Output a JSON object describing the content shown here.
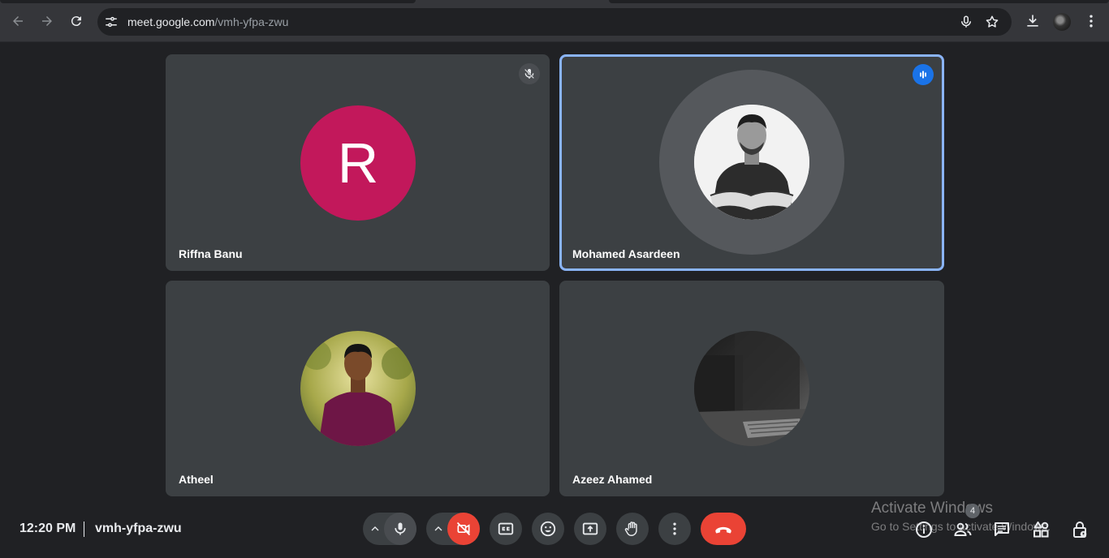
{
  "browser": {
    "url_host": "meet.google.com",
    "url_path": "/vmh-yfpa-zwu",
    "icons": [
      "back-icon",
      "forward-icon",
      "reload-icon",
      "site-settings-icon",
      "voice-search-icon",
      "bookmark-star-icon",
      "download-icon",
      "profile-avatar",
      "kebab-menu-icon"
    ]
  },
  "participants": [
    {
      "name": "Riffna Banu",
      "initial": "R",
      "avatar_color": "#c2185b",
      "muted": true
    },
    {
      "name": "Mohamed Asardeen",
      "speaking": true,
      "highlight_color": "#8ab4f8"
    },
    {
      "name": "Atheel"
    },
    {
      "name": "Azeez Ahamed"
    }
  ],
  "meeting": {
    "time": "12:20 PM",
    "code": "vmh-yfpa-zwu",
    "participant_count": "4"
  },
  "controls": [
    "audio-options-chevron",
    "microphone",
    "video-options-chevron",
    "camera-off",
    "captions",
    "emoji-reactions",
    "present-screen",
    "raise-hand",
    "more-options",
    "leave-call"
  ],
  "side_controls": [
    "meeting-details",
    "people",
    "chat",
    "activities",
    "host-controls"
  ],
  "watermark": {
    "line1": "Activate Windows",
    "line2": "Go to Settings to activate Windows."
  },
  "colors": {
    "accent": "#1a73e8",
    "end_call": "#ea4335",
    "background": "#202124",
    "tile": "#3c4043"
  }
}
